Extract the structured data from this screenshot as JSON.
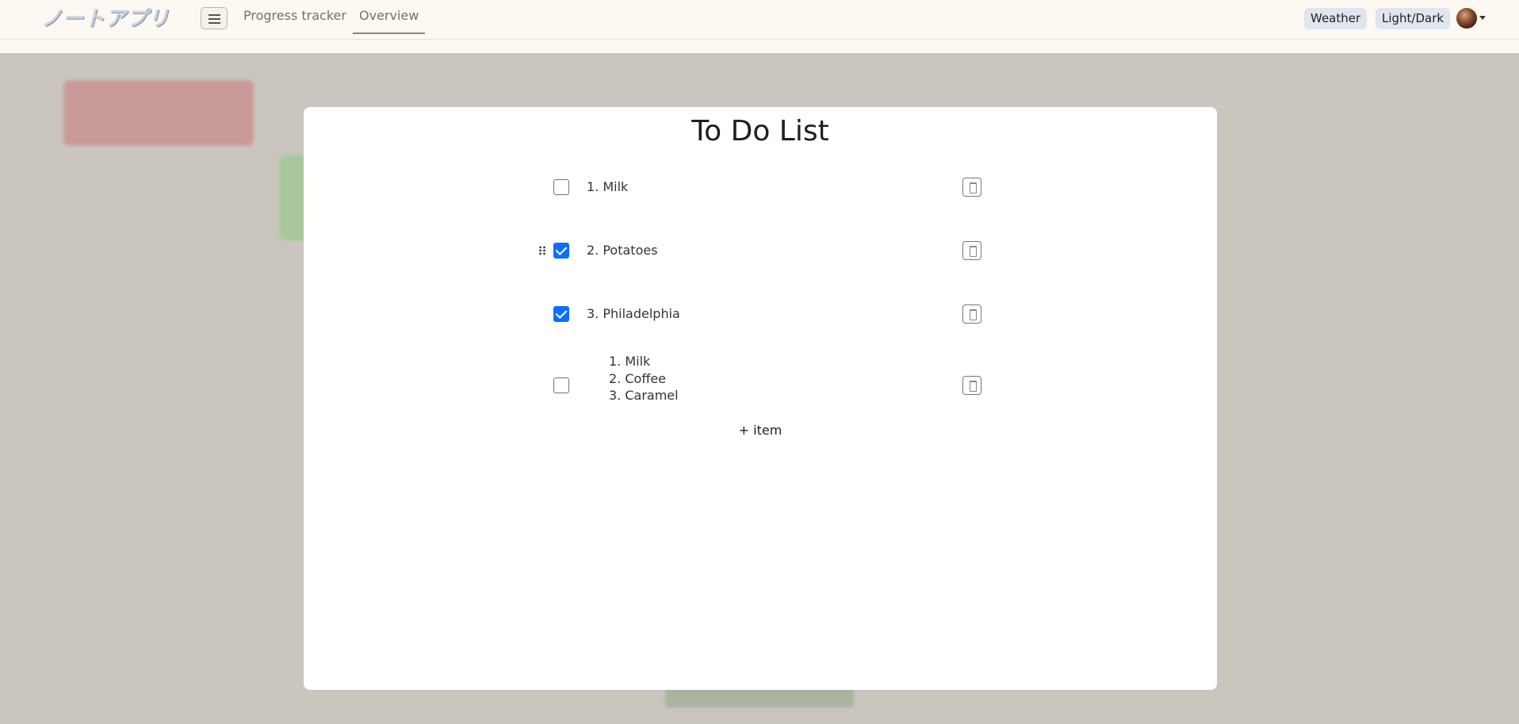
{
  "navbar": {
    "brand": "ノートアプリ",
    "links": [
      "Progress tracker",
      "Overview"
    ],
    "active_link": "Overview",
    "weather_label": "Weather",
    "theme_label": "Light/Dark"
  },
  "modal": {
    "title": "To Do List",
    "items": [
      {
        "text": "1. Milk",
        "checked": false
      },
      {
        "text": "2. Potatoes",
        "checked": true
      },
      {
        "text": "3. Philadelphia",
        "checked": true
      },
      {
        "checked": false,
        "sublist": [
          "1. Milk",
          "2. Coffee",
          "3. Caramel"
        ]
      }
    ],
    "add_item_label": "+ item"
  },
  "colors": {
    "accent": "#0d6efd",
    "navbar_bg": "#fdf8f1",
    "backdrop": "#cac6bf"
  },
  "icons": [
    "hamburger-icon",
    "drag-handle-icon",
    "trash-icon",
    "avatar"
  ]
}
